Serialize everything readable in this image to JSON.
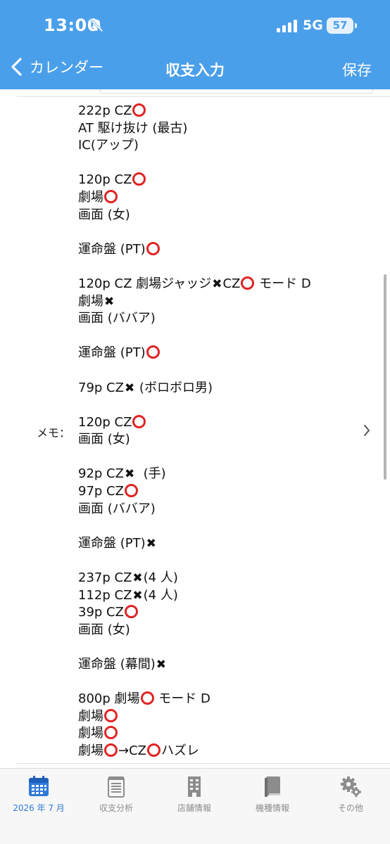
{
  "status_bar": {
    "time": "13:00",
    "network": "5G",
    "battery": "57"
  },
  "nav": {
    "back_label": "カレンダー",
    "title": "収支入力",
    "save_label": "保存"
  },
  "memo": {
    "label": "メモ：",
    "lines": [
      [
        "222p CZ",
        "O"
      ],
      [
        "AT 駆け抜け (最古)"
      ],
      [
        "IC(アップ)"
      ],
      [],
      [
        "120p CZ",
        "O"
      ],
      [
        "劇場",
        "O"
      ],
      [
        "画面 (女)"
      ],
      [],
      [
        "運命盤 (PT)",
        "O"
      ],
      [],
      [
        "120p CZ 劇場ジャッジ",
        "X",
        "CZ",
        "O",
        " モード D"
      ],
      [
        "劇場",
        "X"
      ],
      [
        "画面 (ババア)"
      ],
      [],
      [
        "運命盤 (PT)",
        "O"
      ],
      [],
      [
        "79p CZ",
        "X",
        " (ボロボロ男)"
      ],
      [],
      [
        "120p CZ",
        "O"
      ],
      [
        "画面 (女)"
      ],
      [],
      [
        "92p CZ",
        "X",
        "  (手)"
      ],
      [
        "97p CZ",
        "O"
      ],
      [
        "画面 (ババア)"
      ],
      [],
      [
        "運命盤 (PT)",
        "X"
      ],
      [],
      [
        "237p CZ",
        "X",
        "(4 人)"
      ],
      [
        "112p CZ",
        "X",
        "(4 人)"
      ],
      [
        "39p CZ",
        "O"
      ],
      [
        "画面 (女)"
      ],
      [],
      [
        "運命盤 (幕間)",
        "X"
      ],
      [],
      [
        "800p 劇場",
        "O",
        " モード D"
      ],
      [
        "劇場",
        "O"
      ],
      [
        "劇場",
        "O"
      ],
      [
        "劇場",
        "O",
        "→CZ",
        "O",
        "ハズレ"
      ]
    ]
  },
  "tabs": [
    {
      "label": "2026 年 7 月",
      "icon": "calendar-icon",
      "active": true
    },
    {
      "label": "収支分析",
      "icon": "notepad-icon",
      "active": false
    },
    {
      "label": "店舗情報",
      "icon": "building-icon",
      "active": false
    },
    {
      "label": "機種情報",
      "icon": "book-icon",
      "active": false
    },
    {
      "label": "その他",
      "icon": "gears-icon",
      "active": false
    }
  ],
  "colors": {
    "header": "#4a9fea",
    "circle_mark": "#e02424",
    "active_tab": "#2f7ad8",
    "inactive_tab": "#8c8c8c"
  }
}
